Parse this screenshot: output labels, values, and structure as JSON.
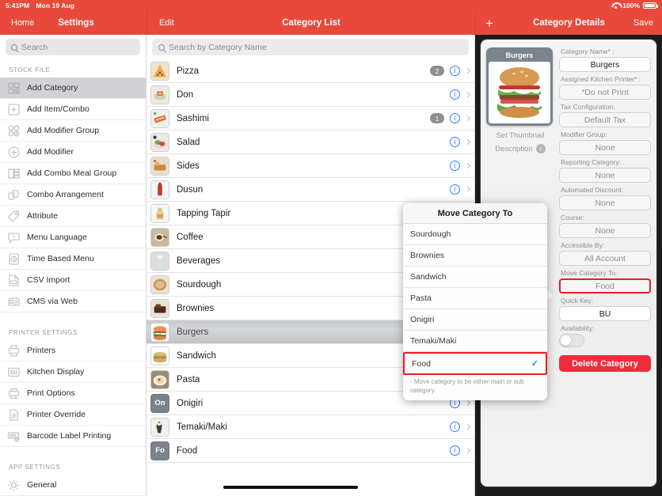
{
  "status_bar": {
    "time": "5:41PM",
    "date": "Mon 19 Aug",
    "battery": "100%"
  },
  "nav": {
    "left": {
      "back": "Home",
      "title": "Settings"
    },
    "middle": {
      "edit": "Edit",
      "title": "Category List"
    },
    "right": {
      "add": "+",
      "title": "Category Details",
      "save": "Save"
    }
  },
  "sidebar": {
    "search_placeholder": "Search",
    "sections": [
      {
        "header": "STOCK FILE",
        "items": [
          {
            "label": "Add Category",
            "icon": "grid-add-icon",
            "selected": true
          },
          {
            "label": "Add Item/Combo",
            "icon": "plus-square-icon",
            "selected": false
          },
          {
            "label": "Add Modifier Group",
            "icon": "circles-add-icon",
            "selected": false
          },
          {
            "label": "Add Modifier",
            "icon": "plus-circle-icon",
            "selected": false
          },
          {
            "label": "Add Combo Meal Group",
            "icon": "stack-icon",
            "selected": false
          },
          {
            "label": "Combo Arrangement",
            "icon": "arrange-icon",
            "selected": false
          },
          {
            "label": "Attribute",
            "icon": "tag-icon",
            "selected": false
          },
          {
            "label": "Menu Language",
            "icon": "speech-bubble-icon",
            "selected": false
          },
          {
            "label": "Time Based Menu",
            "icon": "clock-doc-icon",
            "selected": false
          },
          {
            "label": "CSV Import",
            "icon": "csv-file-icon",
            "selected": false
          },
          {
            "label": "CMS via Web",
            "icon": "web-card-icon",
            "selected": false
          }
        ]
      },
      {
        "header": "PRINTER SETTINGS",
        "items": [
          {
            "label": "Printers",
            "icon": "printer-icon",
            "selected": false
          },
          {
            "label": "Kitchen Display",
            "icon": "display-icon",
            "selected": false
          },
          {
            "label": "Print Options",
            "icon": "print-options-icon",
            "selected": false
          },
          {
            "label": "Printer Override",
            "icon": "document-icon",
            "selected": false
          },
          {
            "label": "Barcode Label Printing",
            "icon": "barcode-icon",
            "selected": false
          }
        ]
      },
      {
        "header": "APP SETTINGS",
        "items": [
          {
            "label": "General",
            "icon": "gear-icon",
            "selected": false
          }
        ]
      }
    ]
  },
  "category_list": {
    "search_placeholder": "Search by Category Name",
    "rows": [
      {
        "name": "Pizza",
        "badge": "2",
        "thumb": "photo",
        "thumb_letters": "",
        "selected": false
      },
      {
        "name": "Don",
        "badge": "",
        "thumb": "photo",
        "thumb_letters": "",
        "selected": false
      },
      {
        "name": "Sashimi",
        "badge": "1",
        "thumb": "photo",
        "thumb_letters": "",
        "selected": false
      },
      {
        "name": "Salad",
        "badge": "",
        "thumb": "photo",
        "thumb_letters": "",
        "selected": false
      },
      {
        "name": "Sides",
        "badge": "",
        "thumb": "photo",
        "thumb_letters": "",
        "selected": false
      },
      {
        "name": "Dusun",
        "badge": "",
        "thumb": "photo",
        "thumb_letters": "",
        "selected": false
      },
      {
        "name": "Tapping Tapir",
        "badge": "",
        "thumb": "photo",
        "thumb_letters": "",
        "selected": false
      },
      {
        "name": "Coffee",
        "badge": "",
        "thumb": "photo",
        "thumb_letters": "",
        "selected": false
      },
      {
        "name": "Beverages",
        "badge": "",
        "thumb": "photo",
        "thumb_letters": "",
        "selected": false
      },
      {
        "name": "Sourdough",
        "badge": "",
        "thumb": "photo",
        "thumb_letters": "",
        "selected": false
      },
      {
        "name": "Brownies",
        "badge": "",
        "thumb": "photo",
        "thumb_letters": "",
        "selected": false
      },
      {
        "name": "Burgers",
        "badge": "",
        "thumb": "photo",
        "thumb_letters": "",
        "selected": true
      },
      {
        "name": "Sandwich",
        "badge": "",
        "thumb": "photo",
        "thumb_letters": "",
        "selected": false
      },
      {
        "name": "Pasta",
        "badge": "",
        "thumb": "photo",
        "thumb_letters": "",
        "selected": false
      },
      {
        "name": "Onigiri",
        "badge": "",
        "thumb": "letters",
        "thumb_letters": "On",
        "selected": false
      },
      {
        "name": "Temaki/Maki",
        "badge": "",
        "thumb": "photo",
        "thumb_letters": "",
        "selected": false
      },
      {
        "name": "Food",
        "badge": "",
        "thumb": "letters",
        "thumb_letters": "Fo",
        "selected": false
      }
    ]
  },
  "details": {
    "thumbnail_title": "Burgers",
    "set_thumbnail": "Set Thumbnail",
    "description_label": "Description",
    "fields": [
      {
        "label": "Category Name* :",
        "value": "Burgers",
        "style": "white",
        "name": "category-name-field"
      },
      {
        "label": "Assigned Kitchen Printer* :",
        "value": "*Do not Print",
        "style": "gray",
        "name": "assigned-kitchen-printer-field"
      },
      {
        "label": "Tax Configuration:",
        "value": "Default Tax",
        "style": "gray",
        "name": "tax-configuration-field"
      },
      {
        "label": "Modifier Group:",
        "value": "None",
        "style": "gray",
        "name": "modifier-group-field"
      },
      {
        "label": "Reporting Category:",
        "value": "None",
        "style": "gray",
        "name": "reporting-category-field"
      },
      {
        "label": "Automated Discount:",
        "value": "None",
        "style": "gray",
        "name": "automated-discount-field"
      },
      {
        "label": "Course:",
        "value": "None",
        "style": "gray",
        "name": "course-field"
      },
      {
        "label": "Accessible By:",
        "value": "All Account",
        "style": "gray",
        "name": "accessible-by-field"
      },
      {
        "label": "Move Category To:",
        "value": "Food",
        "style": "highlight",
        "name": "move-category-to-field"
      },
      {
        "label": "Quick Key:",
        "value": "BU",
        "style": "white",
        "name": "quick-key-field"
      }
    ],
    "availability_label": "Availability:",
    "availability_on": false,
    "delete_button": "Delete Category"
  },
  "popover": {
    "title": "Move Category To",
    "items": [
      {
        "label": "Sourdough",
        "checked": false,
        "highlighted": false
      },
      {
        "label": "Brownies",
        "checked": false,
        "highlighted": false
      },
      {
        "label": "Sandwich",
        "checked": false,
        "highlighted": false
      },
      {
        "label": "Pasta",
        "checked": false,
        "highlighted": false
      },
      {
        "label": "Onigiri",
        "checked": false,
        "highlighted": false
      },
      {
        "label": "Temaki/Maki",
        "checked": false,
        "highlighted": false
      },
      {
        "label": "Food",
        "checked": true,
        "highlighted": true
      }
    ],
    "check_glyph": "✓",
    "note": "- Move category to be either main or sub category."
  },
  "colors": {
    "brand_red": "#e8493a",
    "highlight_red": "#ec1c24",
    "delete_red": "#ee2c3c",
    "accent_blue": "#2b7fff"
  }
}
